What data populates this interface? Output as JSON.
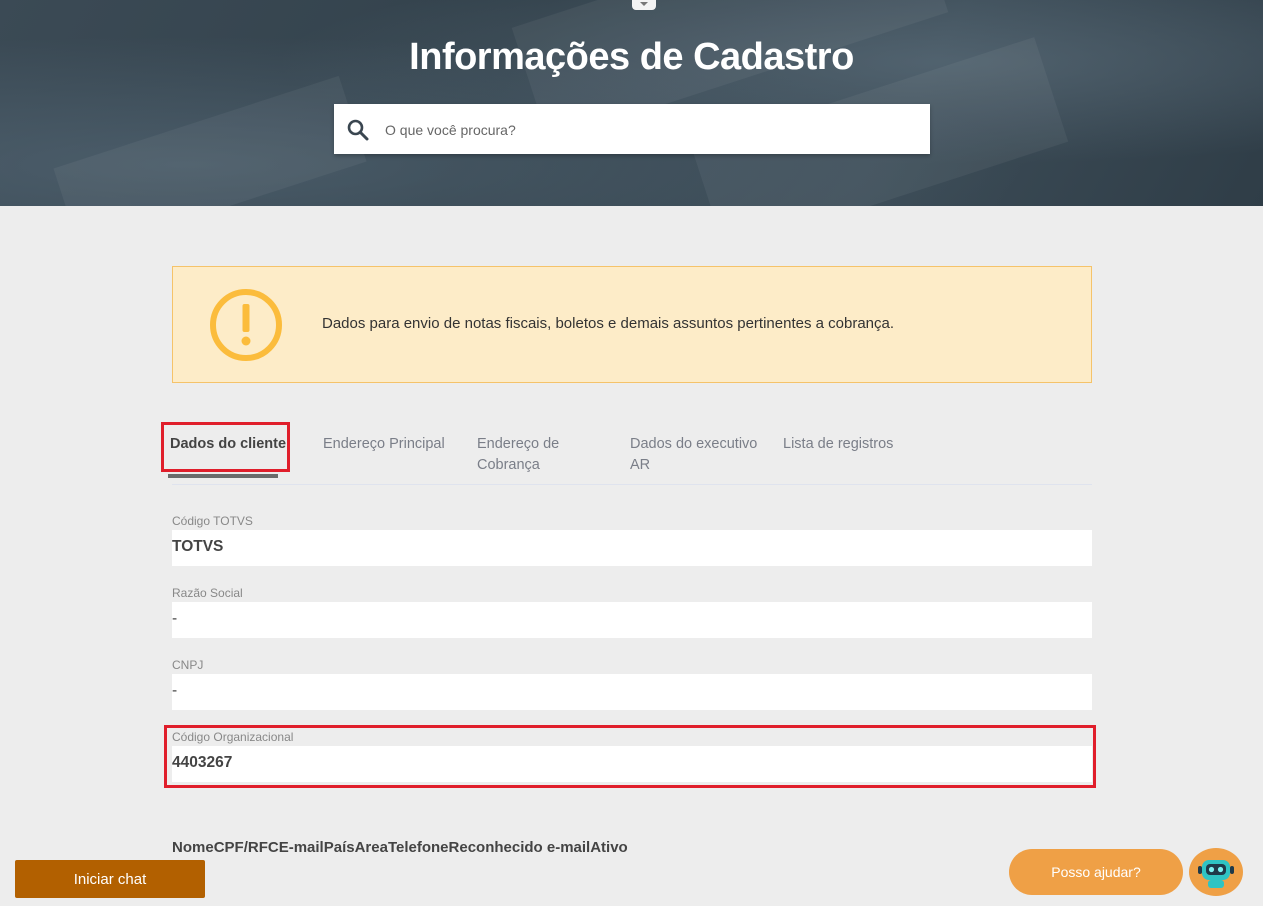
{
  "header": {
    "title": "Informações de Cadastro",
    "search_placeholder": "O que você procura?"
  },
  "alert": {
    "icon": "warning-circle-icon",
    "text": "Dados para envio de notas fiscais, boletos e demais assuntos pertinentes a cobrança."
  },
  "tabs": [
    {
      "label": "Dados do cliente",
      "active": true
    },
    {
      "label": "Endereço Principal",
      "active": false
    },
    {
      "label": "Endereço de Cobrança",
      "active": false
    },
    {
      "label": "Dados do executivo AR",
      "active": false
    },
    {
      "label": "Lista de registros",
      "active": false
    }
  ],
  "fields": [
    {
      "label": "Código TOTVS",
      "value": "TOTVS"
    },
    {
      "label": "Razão Social",
      "value": "-"
    },
    {
      "label": "CNPJ",
      "value": "-"
    },
    {
      "label": "Código Organizacional",
      "value": "4403267"
    }
  ],
  "table_headers": [
    "Nome",
    "CPF/RF",
    "CE-mail",
    "País",
    "Area",
    "Telefone",
    "Reconhecido e-mail",
    "Ativo"
  ],
  "chat": {
    "start_label": "Iniciar chat",
    "help_label": "Posso ajudar?"
  },
  "colors": {
    "accent_orange": "#efa046",
    "chat_button": "#b26000",
    "highlight_red": "#e01e2b",
    "alert_bg": "#fdecc8",
    "warning_icon": "#fbbc3c"
  }
}
